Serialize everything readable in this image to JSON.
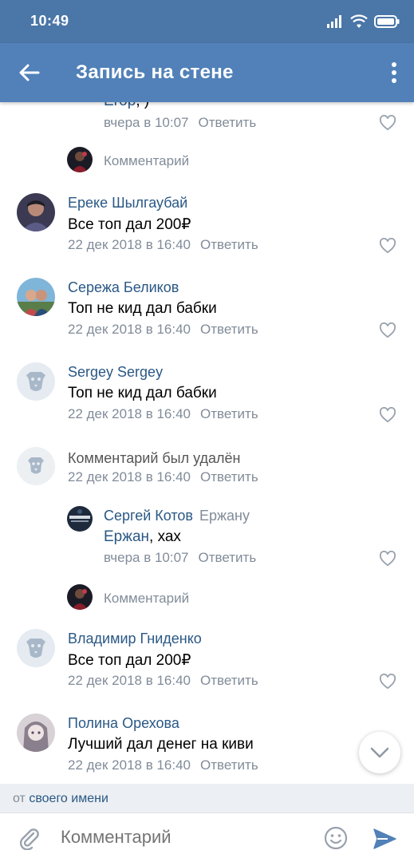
{
  "status_bar": {
    "time": "10:49"
  },
  "app_bar": {
    "title": "Запись на стене"
  },
  "comments": [
    {
      "id": "c0",
      "author": "Егор",
      "text_tail": ", )",
      "time": "вчера в 10:07",
      "reply": "Ответить"
    },
    {
      "id": "c1",
      "author": "Ереке Шылгаубай",
      "text": "Все топ дал 200₽",
      "time": "22 дек 2018 в 16:40",
      "reply": "Ответить"
    },
    {
      "id": "c2",
      "author": "Сережа Беликов",
      "text": "Топ не кид дал бабки",
      "time": "22 дек 2018 в 16:40",
      "reply": "Ответить"
    },
    {
      "id": "c3",
      "author": "Sergey Sergey",
      "text": "Топ не кид дал бабки",
      "time": "22 дек 2018 в 16:40",
      "reply": "Ответить"
    },
    {
      "id": "c4",
      "deleted_text": "Комментарий был удалён",
      "time": "22 дек 2018 в 16:40",
      "reply": "Ответить"
    },
    {
      "id": "c5",
      "author": "Сергей Котов",
      "reply_to": "Ержану",
      "mention": "Ержан",
      "text_tail": ", хах",
      "time": "вчера в 10:07",
      "reply": "Ответить"
    },
    {
      "id": "c6",
      "author": "Владимир Гниденко",
      "text": "Все топ дал 200₽",
      "time": "22 дек 2018 в 16:40",
      "reply": "Ответить"
    },
    {
      "id": "c7",
      "author": "Полина Орехова",
      "text": "Лучший дал денег на киви",
      "time": "22 дек 2018 в 16:40",
      "reply": "Ответить"
    }
  ],
  "thread_prompt": "Комментарий",
  "from_bar": {
    "prefix": "от",
    "link": "своего имени"
  },
  "input": {
    "placeholder": "Комментарий"
  },
  "colors": {
    "header": "#5181b8",
    "status": "#4a76a8",
    "link": "#2a5885",
    "meta": "#818c99"
  }
}
